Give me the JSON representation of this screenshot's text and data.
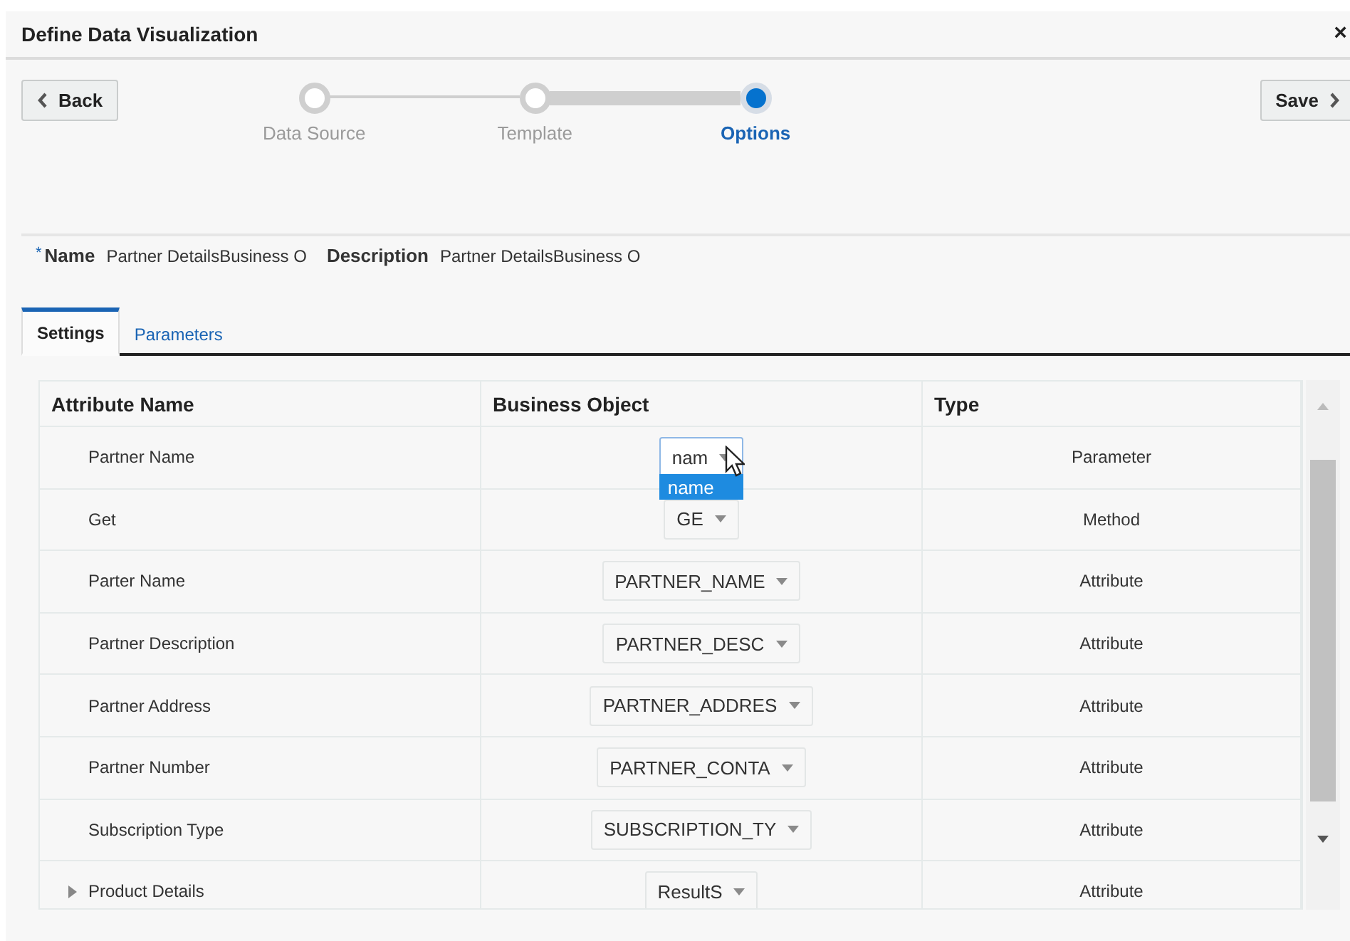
{
  "window": {
    "title": "Define Data Visualization",
    "close": "×"
  },
  "nav": {
    "back": "Back",
    "save": "Save"
  },
  "steps": [
    {
      "label": "Data Source",
      "selected": false
    },
    {
      "label": "Template",
      "selected": false
    },
    {
      "label": "Options",
      "selected": true
    }
  ],
  "form": {
    "required_mark": "*",
    "name_label": "Name",
    "name_value": "Partner DetailsBusiness O",
    "description_label": "Description",
    "description_value": "Partner DetailsBusiness O"
  },
  "tabs": [
    {
      "label": "Settings",
      "selected": true
    },
    {
      "label": "Parameters",
      "selected": false
    }
  ],
  "table": {
    "columns": [
      "Attribute Name",
      "Business Object",
      "Type"
    ],
    "rows": [
      {
        "attribute": "Partner Name",
        "object": "nam",
        "type": "Parameter",
        "open": true,
        "option": "name"
      },
      {
        "attribute": "Get",
        "object": "GE",
        "type": "Method",
        "open": false
      },
      {
        "attribute": "Parter Name",
        "object": "PARTNER_NAME",
        "type": "Attribute",
        "open": false
      },
      {
        "attribute": "Partner Description",
        "object": "PARTNER_DESC",
        "type": "Attribute",
        "open": false
      },
      {
        "attribute": "Partner Address",
        "object": "PARTNER_ADDRES",
        "type": "Attribute",
        "open": false
      },
      {
        "attribute": "Partner Number",
        "object": "PARTNER_CONTA",
        "type": "Attribute",
        "open": false
      },
      {
        "attribute": "Subscription Type",
        "object": "SUBSCRIPTION_TY",
        "type": "Attribute",
        "open": false
      },
      {
        "attribute": "Product Details",
        "object": "ResultS",
        "type": "Attribute",
        "open": false,
        "expanded": false
      }
    ]
  }
}
